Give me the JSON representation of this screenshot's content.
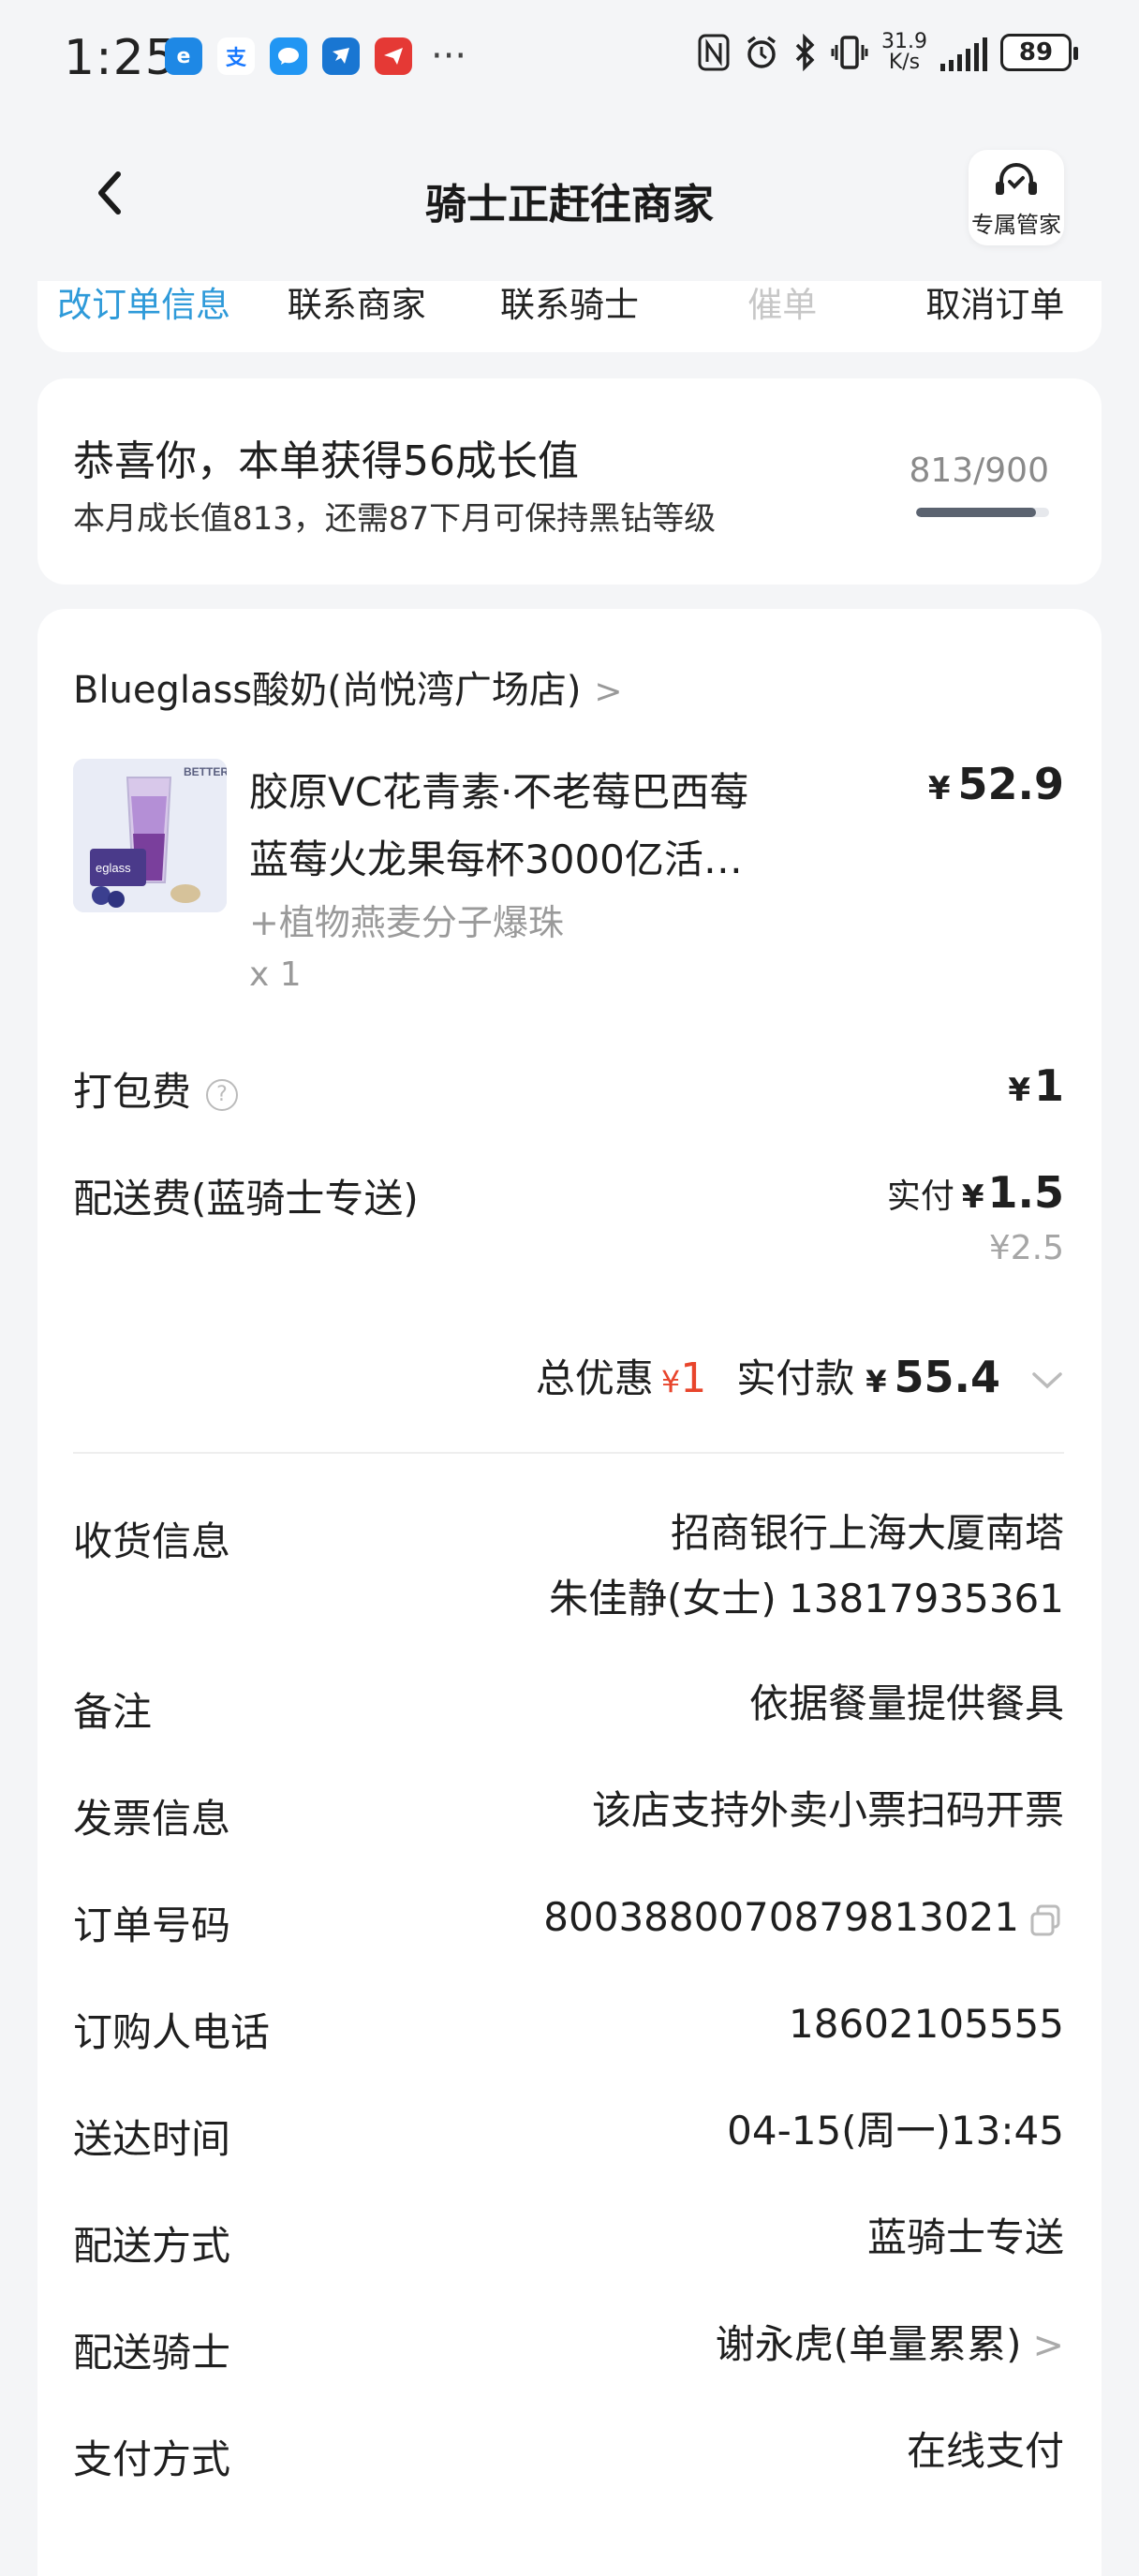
{
  "status_bar": {
    "time": "1:25",
    "app_icons": [
      {
        "name": "browser-app-icon",
        "glyph": "e",
        "color": "#1e88e5"
      },
      {
        "name": "alipay-app-icon",
        "glyph": "支",
        "color": "#ffffff"
      },
      {
        "name": "message-app-icon",
        "glyph": "💬",
        "color": "#2196f3"
      },
      {
        "name": "dingtalk-app-icon",
        "glyph": "✈",
        "color": "#1976d2"
      },
      {
        "name": "red-app-icon",
        "glyph": "✈",
        "color": "#e53935"
      }
    ],
    "more": "···",
    "net_speed_top": "31.9",
    "net_speed_bottom": "K/s",
    "battery": "89"
  },
  "header": {
    "title": "骑士正赶往商家",
    "service_label": "专属管家"
  },
  "actions": [
    {
      "label": "改订单信息",
      "state": "active"
    },
    {
      "label": "联系商家",
      "state": "normal"
    },
    {
      "label": "联系骑士",
      "state": "normal"
    },
    {
      "label": "催单",
      "state": "disabled"
    },
    {
      "label": "取消订单",
      "state": "normal"
    }
  ],
  "growth": {
    "title": "恭喜你，本单获得56成长值",
    "subtitle": "本月成长值813，还需87下月可保持黑钻等级",
    "ratio": "813/900",
    "progress": 0.903
  },
  "order": {
    "shop_name": "Blueglass酸奶(尚悦湾广场店)",
    "product": {
      "name_line1": "胶原VC花青素·不老莓巴西莓",
      "name_line2": "蓝莓火龙果每杯3000亿活…",
      "spec": "+植物燕麦分子爆珠",
      "qty": "x 1",
      "currency": "¥",
      "price": "52.9",
      "thumb_text_top": "BETTER",
      "thumb_text_brand": "eglass"
    },
    "packing": {
      "label": "打包费",
      "currency": "¥",
      "value": "1"
    },
    "delivery": {
      "label": "配送费(蓝骑士专送)",
      "prefix": "实付",
      "currency": "¥",
      "value": "1.5",
      "original": "¥2.5"
    },
    "total": {
      "discount_label": "总优惠",
      "discount_currency": "¥",
      "discount": "1",
      "paid_label": "实付款",
      "paid_currency": "¥",
      "paid": "55.4"
    },
    "info": [
      {
        "key": "收货信息",
        "value": "招商银行上海大厦南塔",
        "value2": "朱佳静(女士) 13817935361"
      },
      {
        "key": "备注",
        "value": "依据餐量提供餐具"
      },
      {
        "key": "发票信息",
        "value": "该店支持外卖小票扫码开票"
      },
      {
        "key": "订单号码",
        "value": "8003880070879813021"
      },
      {
        "key": "订购人电话",
        "value": "18602105555"
      },
      {
        "key": "送达时间",
        "value": "04-15(周一)13:45"
      },
      {
        "key": "配送方式",
        "value": "蓝骑士专送"
      },
      {
        "key": "配送骑士",
        "value": "谢永虎(单量累累)"
      },
      {
        "key": "支付方式",
        "value": "在线支付"
      }
    ]
  }
}
